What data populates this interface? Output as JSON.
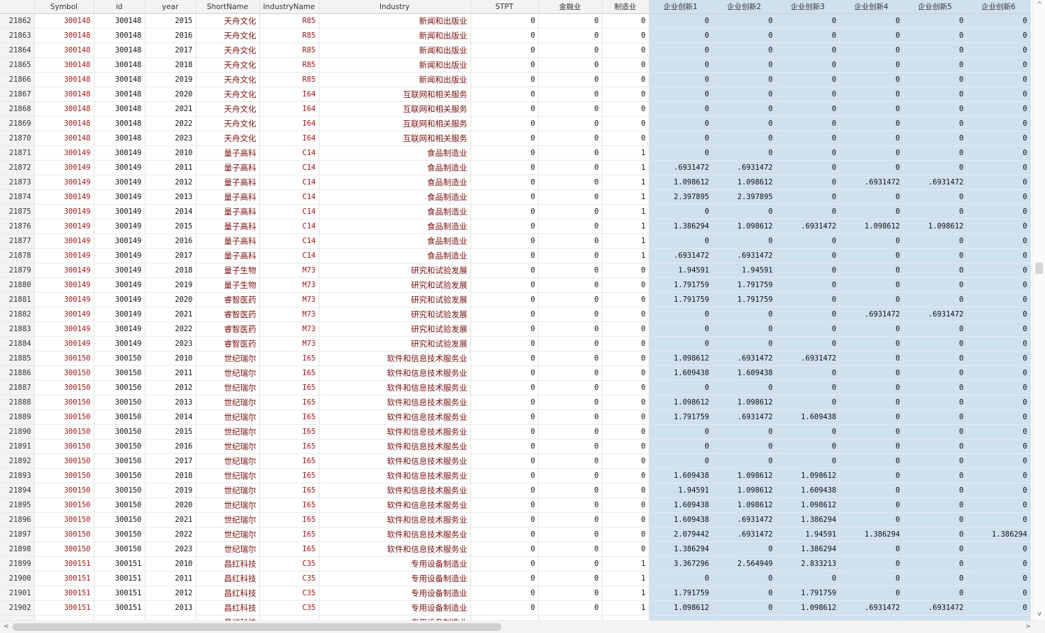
{
  "columns": [
    "",
    "Symbol",
    "id",
    "year",
    "ShortName",
    "IndustryName",
    "Industry",
    "STPT",
    "金融业",
    "制造业",
    "企业创新1",
    "企业创新2",
    "企业创新3",
    "企业创新4",
    "企业创新5",
    "企业创新6"
  ],
  "selection_color": "#cfe0ef",
  "string_color": "#a31515",
  "rows": [
    [
      "21862",
      "300148",
      "300148",
      "2015",
      "天舟文化",
      "R85",
      "新闻和出版业",
      "0",
      "0",
      "0",
      "0",
      "0",
      "0",
      "0",
      "0",
      "0"
    ],
    [
      "21863",
      "300148",
      "300148",
      "2016",
      "天舟文化",
      "R85",
      "新闻和出版业",
      "0",
      "0",
      "0",
      "0",
      "0",
      "0",
      "0",
      "0",
      "0"
    ],
    [
      "21864",
      "300148",
      "300148",
      "2017",
      "天舟文化",
      "R85",
      "新闻和出版业",
      "0",
      "0",
      "0",
      "0",
      "0",
      "0",
      "0",
      "0",
      "0"
    ],
    [
      "21865",
      "300148",
      "300148",
      "2018",
      "天舟文化",
      "R85",
      "新闻和出版业",
      "0",
      "0",
      "0",
      "0",
      "0",
      "0",
      "0",
      "0",
      "0"
    ],
    [
      "21866",
      "300148",
      "300148",
      "2019",
      "天舟文化",
      "R85",
      "新闻和出版业",
      "0",
      "0",
      "0",
      "0",
      "0",
      "0",
      "0",
      "0",
      "0"
    ],
    [
      "21867",
      "300148",
      "300148",
      "2020",
      "天舟文化",
      "I64",
      "互联网和相关服务",
      "0",
      "0",
      "0",
      "0",
      "0",
      "0",
      "0",
      "0",
      "0"
    ],
    [
      "21868",
      "300148",
      "300148",
      "2021",
      "天舟文化",
      "I64",
      "互联网和相关服务",
      "0",
      "0",
      "0",
      "0",
      "0",
      "0",
      "0",
      "0",
      "0"
    ],
    [
      "21869",
      "300148",
      "300148",
      "2022",
      "天舟文化",
      "I64",
      "互联网和相关服务",
      "0",
      "0",
      "0",
      "0",
      "0",
      "0",
      "0",
      "0",
      "0"
    ],
    [
      "21870",
      "300148",
      "300148",
      "2023",
      "天舟文化",
      "I64",
      "互联网和相关服务",
      "0",
      "0",
      "0",
      "0",
      "0",
      "0",
      "0",
      "0",
      "0"
    ],
    [
      "21871",
      "300149",
      "300149",
      "2010",
      "量子高科",
      "C14",
      "食品制造业",
      "0",
      "0",
      "1",
      "0",
      "0",
      "0",
      "0",
      "0",
      "0"
    ],
    [
      "21872",
      "300149",
      "300149",
      "2011",
      "量子高科",
      "C14",
      "食品制造业",
      "0",
      "0",
      "1",
      ".6931472",
      ".6931472",
      "0",
      "0",
      "0",
      "0"
    ],
    [
      "21873",
      "300149",
      "300149",
      "2012",
      "量子高科",
      "C14",
      "食品制造业",
      "0",
      "0",
      "1",
      "1.098612",
      "1.098612",
      "0",
      ".6931472",
      ".6931472",
      "0"
    ],
    [
      "21874",
      "300149",
      "300149",
      "2013",
      "量子高科",
      "C14",
      "食品制造业",
      "0",
      "0",
      "1",
      "2.397895",
      "2.397895",
      "0",
      "0",
      "0",
      "0"
    ],
    [
      "21875",
      "300149",
      "300149",
      "2014",
      "量子高科",
      "C14",
      "食品制造业",
      "0",
      "0",
      "1",
      "0",
      "0",
      "0",
      "0",
      "0",
      "0"
    ],
    [
      "21876",
      "300149",
      "300149",
      "2015",
      "量子高科",
      "C14",
      "食品制造业",
      "0",
      "0",
      "1",
      "1.386294",
      "1.098612",
      ".6931472",
      "1.098612",
      "1.098612",
      "0"
    ],
    [
      "21877",
      "300149",
      "300149",
      "2016",
      "量子高科",
      "C14",
      "食品制造业",
      "0",
      "0",
      "1",
      "0",
      "0",
      "0",
      "0",
      "0",
      "0"
    ],
    [
      "21878",
      "300149",
      "300149",
      "2017",
      "量子高科",
      "C14",
      "食品制造业",
      "0",
      "0",
      "1",
      ".6931472",
      ".6931472",
      "0",
      "0",
      "0",
      "0"
    ],
    [
      "21879",
      "300149",
      "300149",
      "2018",
      "量子生物",
      "M73",
      "研究和试验发展",
      "0",
      "0",
      "0",
      "1.94591",
      "1.94591",
      "0",
      "0",
      "0",
      "0"
    ],
    [
      "21880",
      "300149",
      "300149",
      "2019",
      "量子生物",
      "M73",
      "研究和试验发展",
      "0",
      "0",
      "0",
      "1.791759",
      "1.791759",
      "0",
      "0",
      "0",
      "0"
    ],
    [
      "21881",
      "300149",
      "300149",
      "2020",
      "睿智医药",
      "M73",
      "研究和试验发展",
      "0",
      "0",
      "0",
      "1.791759",
      "1.791759",
      "0",
      "0",
      "0",
      "0"
    ],
    [
      "21882",
      "300149",
      "300149",
      "2021",
      "睿智医药",
      "M73",
      "研究和试验发展",
      "0",
      "0",
      "0",
      "0",
      "0",
      "0",
      ".6931472",
      ".6931472",
      "0"
    ],
    [
      "21883",
      "300149",
      "300149",
      "2022",
      "睿智医药",
      "M73",
      "研究和试验发展",
      "0",
      "0",
      "0",
      "0",
      "0",
      "0",
      "0",
      "0",
      "0"
    ],
    [
      "21884",
      "300149",
      "300149",
      "2023",
      "睿智医药",
      "M73",
      "研究和试验发展",
      "0",
      "0",
      "0",
      "0",
      "0",
      "0",
      "0",
      "0",
      "0"
    ],
    [
      "21885",
      "300150",
      "300150",
      "2010",
      "世纪瑞尔",
      "I65",
      "软件和信息技术服务业",
      "0",
      "0",
      "0",
      "1.098612",
      ".6931472",
      ".6931472",
      "0",
      "0",
      "0"
    ],
    [
      "21886",
      "300150",
      "300150",
      "2011",
      "世纪瑞尔",
      "I65",
      "软件和信息技术服务业",
      "0",
      "0",
      "0",
      "1.609438",
      "1.609438",
      "0",
      "0",
      "0",
      "0"
    ],
    [
      "21887",
      "300150",
      "300150",
      "2012",
      "世纪瑞尔",
      "I65",
      "软件和信息技术服务业",
      "0",
      "0",
      "0",
      "0",
      "0",
      "0",
      "0",
      "0",
      "0"
    ],
    [
      "21888",
      "300150",
      "300150",
      "2013",
      "世纪瑞尔",
      "I65",
      "软件和信息技术服务业",
      "0",
      "0",
      "0",
      "1.098612",
      "1.098612",
      "0",
      "0",
      "0",
      "0"
    ],
    [
      "21889",
      "300150",
      "300150",
      "2014",
      "世纪瑞尔",
      "I65",
      "软件和信息技术服务业",
      "0",
      "0",
      "0",
      "1.791759",
      ".6931472",
      "1.609438",
      "0",
      "0",
      "0"
    ],
    [
      "21890",
      "300150",
      "300150",
      "2015",
      "世纪瑞尔",
      "I65",
      "软件和信息技术服务业",
      "0",
      "0",
      "0",
      "0",
      "0",
      "0",
      "0",
      "0",
      "0"
    ],
    [
      "21891",
      "300150",
      "300150",
      "2016",
      "世纪瑞尔",
      "I65",
      "软件和信息技术服务业",
      "0",
      "0",
      "0",
      "0",
      "0",
      "0",
      "0",
      "0",
      "0"
    ],
    [
      "21892",
      "300150",
      "300150",
      "2017",
      "世纪瑞尔",
      "I65",
      "软件和信息技术服务业",
      "0",
      "0",
      "0",
      "0",
      "0",
      "0",
      "0",
      "0",
      "0"
    ],
    [
      "21893",
      "300150",
      "300150",
      "2018",
      "世纪瑞尔",
      "I65",
      "软件和信息技术服务业",
      "0",
      "0",
      "0",
      "1.609438",
      "1.098612",
      "1.098612",
      "0",
      "0",
      "0"
    ],
    [
      "21894",
      "300150",
      "300150",
      "2019",
      "世纪瑞尔",
      "I65",
      "软件和信息技术服务业",
      "0",
      "0",
      "0",
      "1.94591",
      "1.098612",
      "1.609438",
      "0",
      "0",
      "0"
    ],
    [
      "21895",
      "300150",
      "300150",
      "2020",
      "世纪瑞尔",
      "I65",
      "软件和信息技术服务业",
      "0",
      "0",
      "0",
      "1.609438",
      "1.098612",
      "1.098612",
      "0",
      "0",
      "0"
    ],
    [
      "21896",
      "300150",
      "300150",
      "2021",
      "世纪瑞尔",
      "I65",
      "软件和信息技术服务业",
      "0",
      "0",
      "0",
      "1.609438",
      ".6931472",
      "1.386294",
      "0",
      "0",
      "0"
    ],
    [
      "21897",
      "300150",
      "300150",
      "2022",
      "世纪瑞尔",
      "I65",
      "软件和信息技术服务业",
      "0",
      "0",
      "0",
      "2.079442",
      ".6931472",
      "1.94591",
      "1.386294",
      "0",
      "1.386294"
    ],
    [
      "21898",
      "300150",
      "300150",
      "2023",
      "世纪瑞尔",
      "I65",
      "软件和信息技术服务业",
      "0",
      "0",
      "0",
      "1.386294",
      "0",
      "1.386294",
      "0",
      "0",
      "0"
    ],
    [
      "21899",
      "300151",
      "300151",
      "2010",
      "昌红科技",
      "C35",
      "专用设备制造业",
      "0",
      "0",
      "1",
      "3.367296",
      "2.564949",
      "2.833213",
      "0",
      "0",
      "0"
    ],
    [
      "21900",
      "300151",
      "300151",
      "2011",
      "昌红科技",
      "C35",
      "专用设备制造业",
      "0",
      "0",
      "1",
      "0",
      "0",
      "0",
      "0",
      "0",
      "0"
    ],
    [
      "21901",
      "300151",
      "300151",
      "2012",
      "昌红科技",
      "C35",
      "专用设备制造业",
      "0",
      "0",
      "1",
      "1.791759",
      "0",
      "1.791759",
      "0",
      "0",
      "0"
    ],
    [
      "21902",
      "300151",
      "300151",
      "2013",
      "昌红科技",
      "C35",
      "专用设备制造业",
      "0",
      "0",
      "1",
      "1.098612",
      "0",
      "1.098612",
      ".6931472",
      ".6931472",
      "0"
    ],
    [
      "",
      "",
      "",
      "",
      "昌红科技",
      "",
      "专用设备制造业",
      "",
      "",
      "",
      "",
      "",
      "",
      "",
      "",
      ""
    ]
  ],
  "scroll": {
    "up_icon": "^",
    "down_icon": "v",
    "left_icon": "<",
    "right_icon": ">"
  }
}
